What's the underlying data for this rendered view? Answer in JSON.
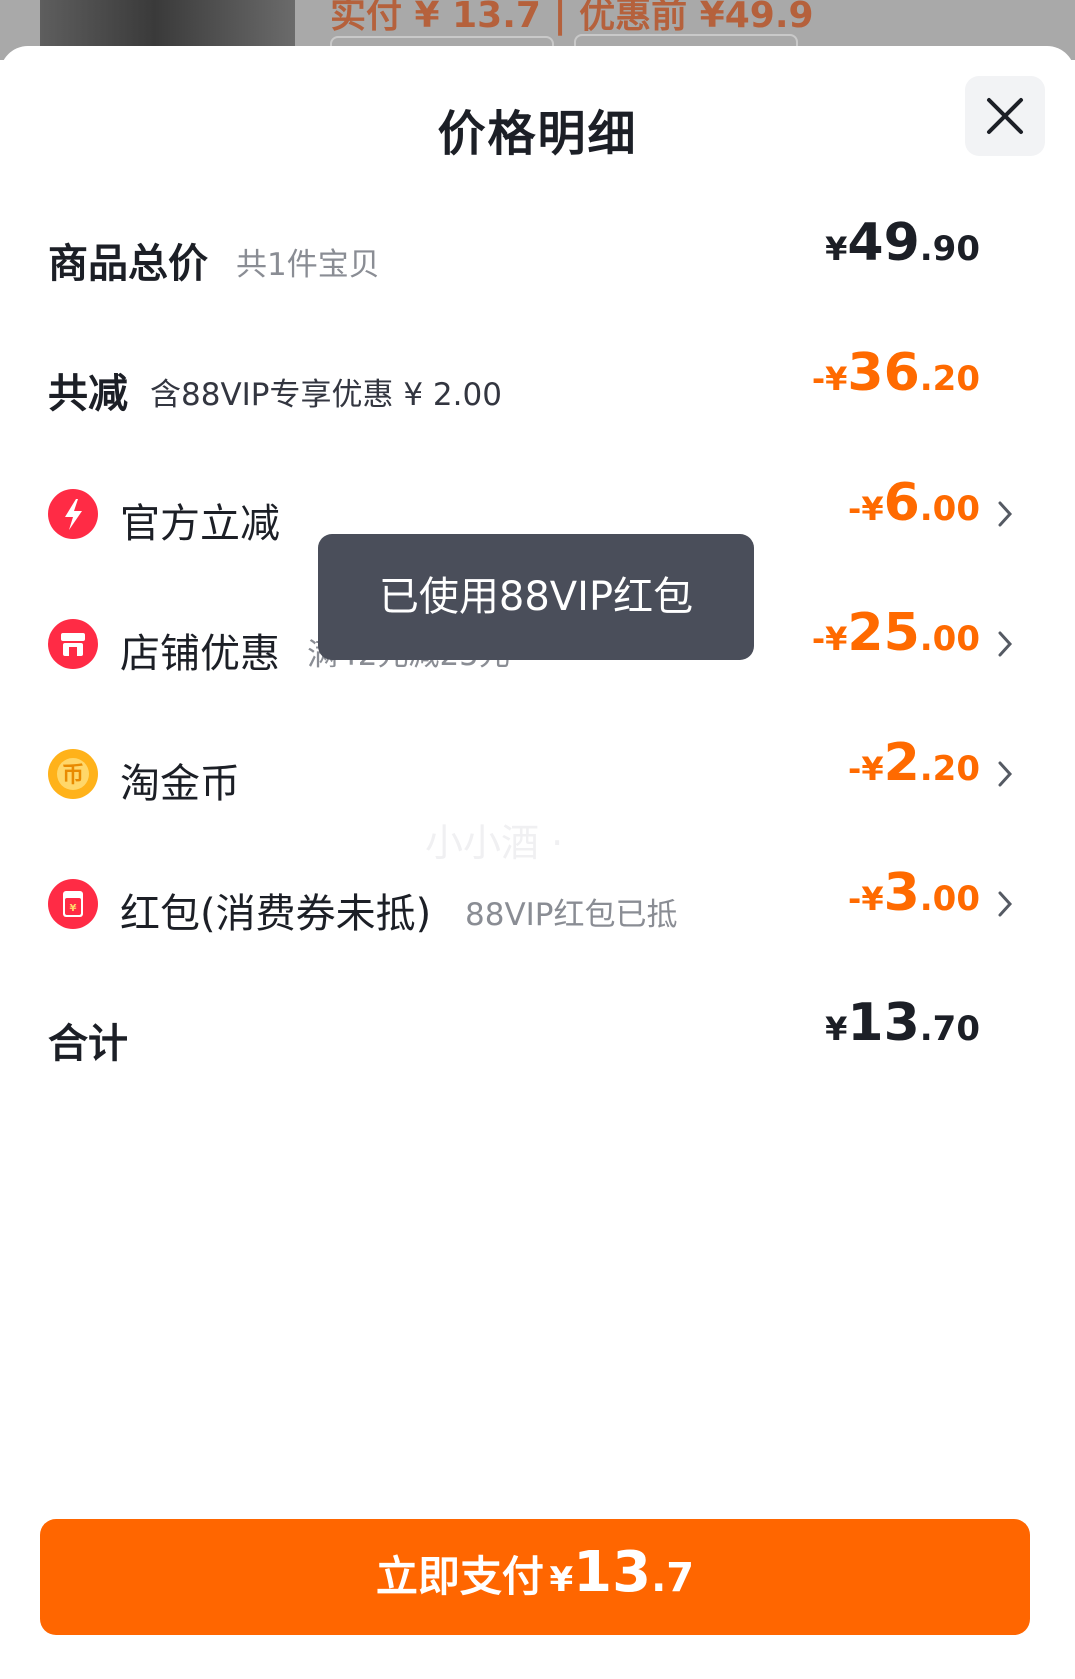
{
  "background": {
    "text": "实付 ¥ 13.7 | 优惠前 ¥49.9"
  },
  "sheet": {
    "title": "价格明细",
    "close_icon": "close-icon"
  },
  "rows": {
    "total": {
      "label": "商品总价",
      "sub": "共1件宝贝",
      "currency": "¥",
      "int": "49",
      "dec": ".90"
    },
    "discount": {
      "label": "共减",
      "sub": "含88VIP专享优惠 ¥ 2.00",
      "currency": "-¥",
      "int": "36",
      "dec": ".20"
    },
    "official": {
      "label": "官方立减",
      "icon": "lightning-icon",
      "icon_color": "#ff2b45",
      "currency": "-¥",
      "int": "6",
      "dec": ".00"
    },
    "store": {
      "label": "店铺优惠",
      "sub": "满42元减25元",
      "icon": "store-icon",
      "icon_color": "#ff2b45",
      "currency": "-¥",
      "int": "25",
      "dec": ".00"
    },
    "coin": {
      "label": "淘金币",
      "icon": "coin-icon",
      "icon_color": "#ffb21a",
      "currency": "-¥",
      "int": "2",
      "dec": ".20"
    },
    "redpacket": {
      "label": "红包(消费券未抵)",
      "sub": "88VIP红包已抵",
      "icon": "red-packet-icon",
      "icon_color": "#ff2b45",
      "currency": "-¥",
      "int": "3",
      "dec": ".00"
    },
    "sum": {
      "label": "合计",
      "currency": "¥",
      "int": "13",
      "dec": ".70"
    }
  },
  "toast": {
    "text": "已使用88VIP红包"
  },
  "watermark": {
    "text": "小小酒 ·"
  },
  "pay_button": {
    "label": "立即支付",
    "currency": "¥",
    "int": "13",
    "dec": ".7"
  },
  "colors": {
    "accent": "#ff6600",
    "discount": "#ff6a00",
    "text": "#1c1f26",
    "subtext": "#8a8d94"
  }
}
